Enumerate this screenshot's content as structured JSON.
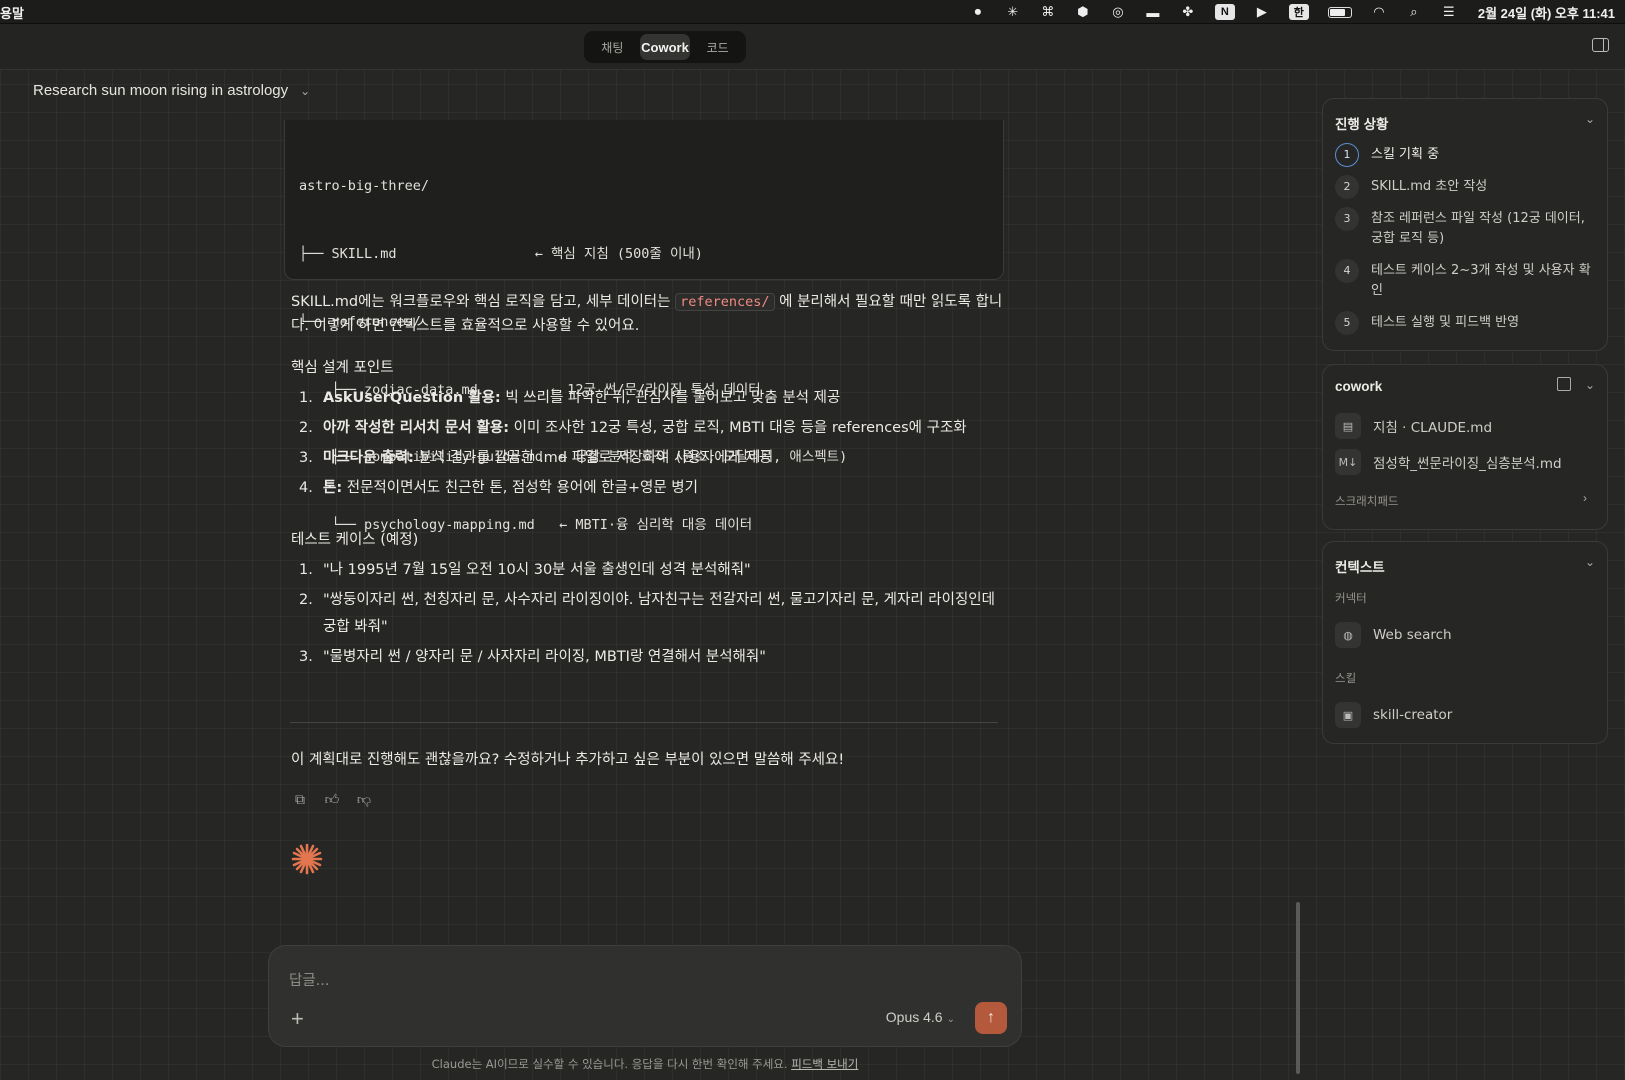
{
  "menubar": {
    "app": "용말",
    "clock": "2월 24일 (화) 오후 11:41",
    "input_source": "한",
    "notion": "N"
  },
  "tabs": [
    {
      "label": "채팅"
    },
    {
      "label": "Cowork"
    },
    {
      "label": "코드"
    }
  ],
  "conversation": {
    "title": "Research sun moon rising in astrology"
  },
  "code_block": {
    "lines": [
      "astro-big-three/",
      "├── SKILL.md                 ← 핵심 지침 (500줄 이내)",
      "└── references/",
      "    ├── zodiac-data.md         ← 12궁 썬/문/라이징 특성 데이터",
      "    ├── compatibility-guide.md  ← 궁합 분석 로직 (원소, 모달리티, 애스펙트)",
      "    └── psychology-mapping.md   ← MBTI·융 심리학 대응 데이터"
    ]
  },
  "message": {
    "para_before": "SKILL.md에는 워크플로우와 핵심 로직을 담고, 세부 데이터는 ",
    "para_code": "references/",
    "para_after": " 에 분리해서 필요할 때만 읽도록 합니다. 이렇게 하면 컨텍스트를 효율적으로 사용할 수 있어요.",
    "design_heading": "핵심 설계 포인트",
    "design_points": [
      {
        "num": "1.",
        "bold": "AskUserQuestion 활용:",
        "text": " 빅 쓰리를 파악한 뒤, 관심사를 물어보고 맞춤 분석 제공"
      },
      {
        "num": "2.",
        "bold": "아까 작성한 리서치 문서 활용:",
        "text": " 이미 조사한 12궁 특성, 궁합 로직, MBTI 대응 등을 references에 구조화"
      },
      {
        "num": "3.",
        "bold": "마크다운 출력:",
        "text": " 분석 결과를 깔끔한 .md 파일로 저장하여 사용자에게 제공"
      },
      {
        "num": "4.",
        "bold": "톤:",
        "text": " 전문적이면서도 친근한 톤, 점성학 용어에 한글+영문 병기"
      }
    ],
    "test_heading": "테스트 케이스 (예정)",
    "test_cases": [
      {
        "num": "1.",
        "text": "\"나 1995년 7월 15일 오전 10시 30분 서울 출생인데 성격 분석해줘\""
      },
      {
        "num": "2.",
        "text": "\"쌍둥이자리 썬, 천칭자리 문, 사수자리 라이징이야. 남자친구는 전갈자리 썬, 물고기자리 문, 게자리 라이징인데 궁합 봐줘\""
      },
      {
        "num": "3.",
        "text": "\"물병자리 썬 / 양자리 문 / 사자자리 라이징, MBTI랑 연결해서 분석해줘\""
      }
    ],
    "closing": "이 계획대로 진행해도 괜찮을까요? 수정하거나 추가하고 싶은 부분이 있으면 말씀해 주세요!"
  },
  "composer": {
    "placeholder": "답글...",
    "model": "Opus 4.6",
    "disclaimer": "Claude는 AI이므로 실수할 수 있습니다. 응답을 다시 한번 확인해 주세요.",
    "feedback_link": "피드백 보내기"
  },
  "progress": {
    "title": "진행 상황",
    "steps": [
      {
        "n": "1",
        "label": "스킬 기획 중",
        "active": true
      },
      {
        "n": "2",
        "label": "SKILL.md 초안 작성"
      },
      {
        "n": "3",
        "label": "참조 레퍼런스 파일 작성 (12궁 데이터, 궁합 로직 등)"
      },
      {
        "n": "4",
        "label": "테스트 케이스 2~3개 작성 및 사용자 확인"
      },
      {
        "n": "5",
        "label": "테스트 실행 및 피드백 반영"
      }
    ]
  },
  "cowork": {
    "title": "cowork",
    "files": [
      {
        "icon": "document-icon",
        "label": "지침 · CLAUDE.md"
      },
      {
        "icon": "markdown-file-icon",
        "label": "점성학_썬문라이징_심층분석.md"
      }
    ],
    "scratchpad": "스크래치패드"
  },
  "context": {
    "title": "컨텍스트",
    "connector_label": "커넥터",
    "connector": "Web search",
    "skill_label": "스킬",
    "skill": "skill-creator"
  },
  "colors": {
    "accent_send": "#b5593c",
    "active_step_ring": "#5b8ed6",
    "claude_star": "#e2764f",
    "inline_code": "#f08a84"
  }
}
